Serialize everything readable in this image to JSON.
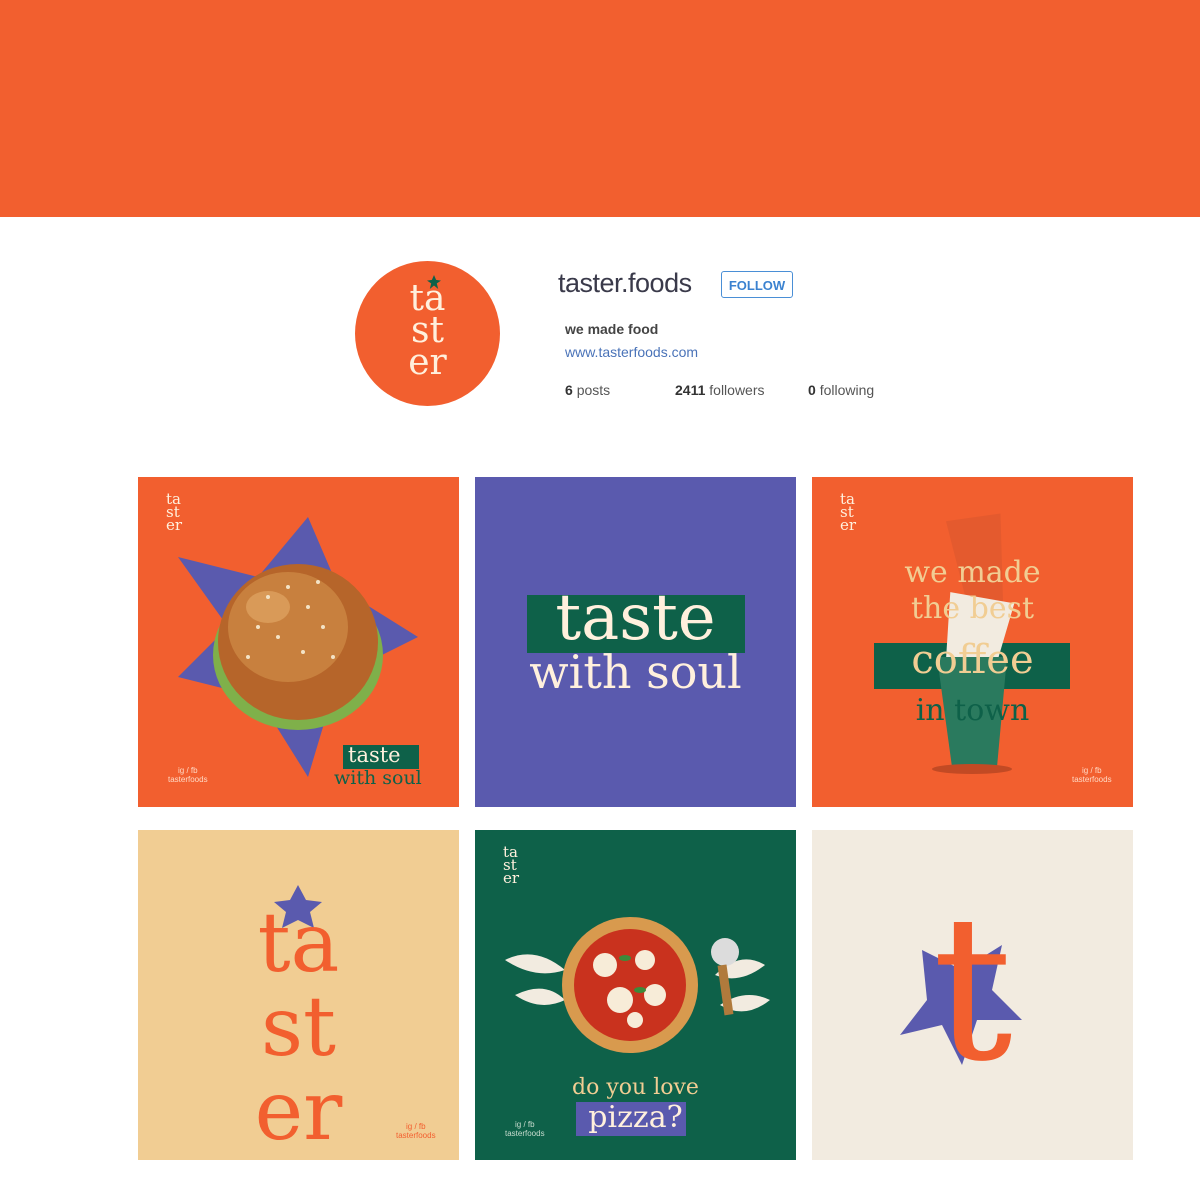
{
  "profile": {
    "avatar_logo": "ta\nst\ner",
    "username": "taster.foods",
    "follow_label": "FOLLOW",
    "bio": "we made food",
    "website": "www.tasterfoods.com",
    "stats": {
      "posts_count": "6",
      "posts_label": "posts",
      "followers_count": "2411",
      "followers_label": "followers",
      "following_count": "0",
      "following_label": "following"
    }
  },
  "posts": [
    {
      "logo": "ta\nst\ner",
      "line1": "taste",
      "line2": "with soul",
      "footer": "ig / fb\ntasterfoods"
    },
    {
      "line1": "taste",
      "line2": "with soul"
    },
    {
      "logo": "ta\nst\ner",
      "line1": "we made",
      "line2": "the best",
      "line3": "coffee",
      "line4": "in town",
      "footer": "ig / fb\ntasterfoods"
    },
    {
      "word": "ta\nst\ner",
      "footer": "ig / fb\ntasterfoods"
    },
    {
      "logo": "ta\nst\ner",
      "line1": "do you love",
      "line2": "pizza?",
      "footer": "ig / fb\ntasterfoods"
    },
    {
      "glyph": "t"
    }
  ],
  "colors": {
    "brand_orange": "#f25f2f",
    "brand_purple": "#5a5aae",
    "brand_green": "#0e6149",
    "cream": "#f2ebe0",
    "peach": "#f1cd93"
  }
}
